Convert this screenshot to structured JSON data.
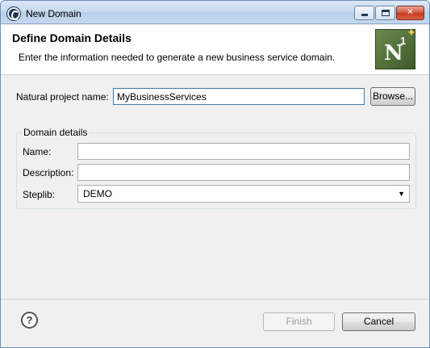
{
  "window": {
    "title": "New Domain",
    "icon": "eclipse-app-icon",
    "controls": {
      "minimize_icon": "minimize-icon",
      "maximize_icon": "maximize-icon",
      "close_label": "✕"
    }
  },
  "header": {
    "title": "Define Domain Details",
    "description": "Enter the information needed to generate a new business service domain.",
    "logo": {
      "letter": "N",
      "superscript": "1",
      "star": "✦"
    }
  },
  "project": {
    "label": "Natural project name:",
    "value": "MyBusinessServices",
    "browse_label": "Browse..."
  },
  "domain_details": {
    "group_title": "Domain details",
    "name_label": "Name:",
    "name_value": "",
    "description_label": "Description:",
    "description_value": "",
    "steplib_label": "Steplib:",
    "steplib_value": "DEMO",
    "steplib_arrow": "▼"
  },
  "footer": {
    "help_label": "?",
    "finish_label": "Finish",
    "cancel_label": "Cancel"
  },
  "colors": {
    "titlebar": "#c6d9ef",
    "dialog_bg": "#f0f0f0",
    "header_bg": "#ffffff",
    "logo_green": "#4f6b36",
    "close_red": "#c43a1f"
  }
}
